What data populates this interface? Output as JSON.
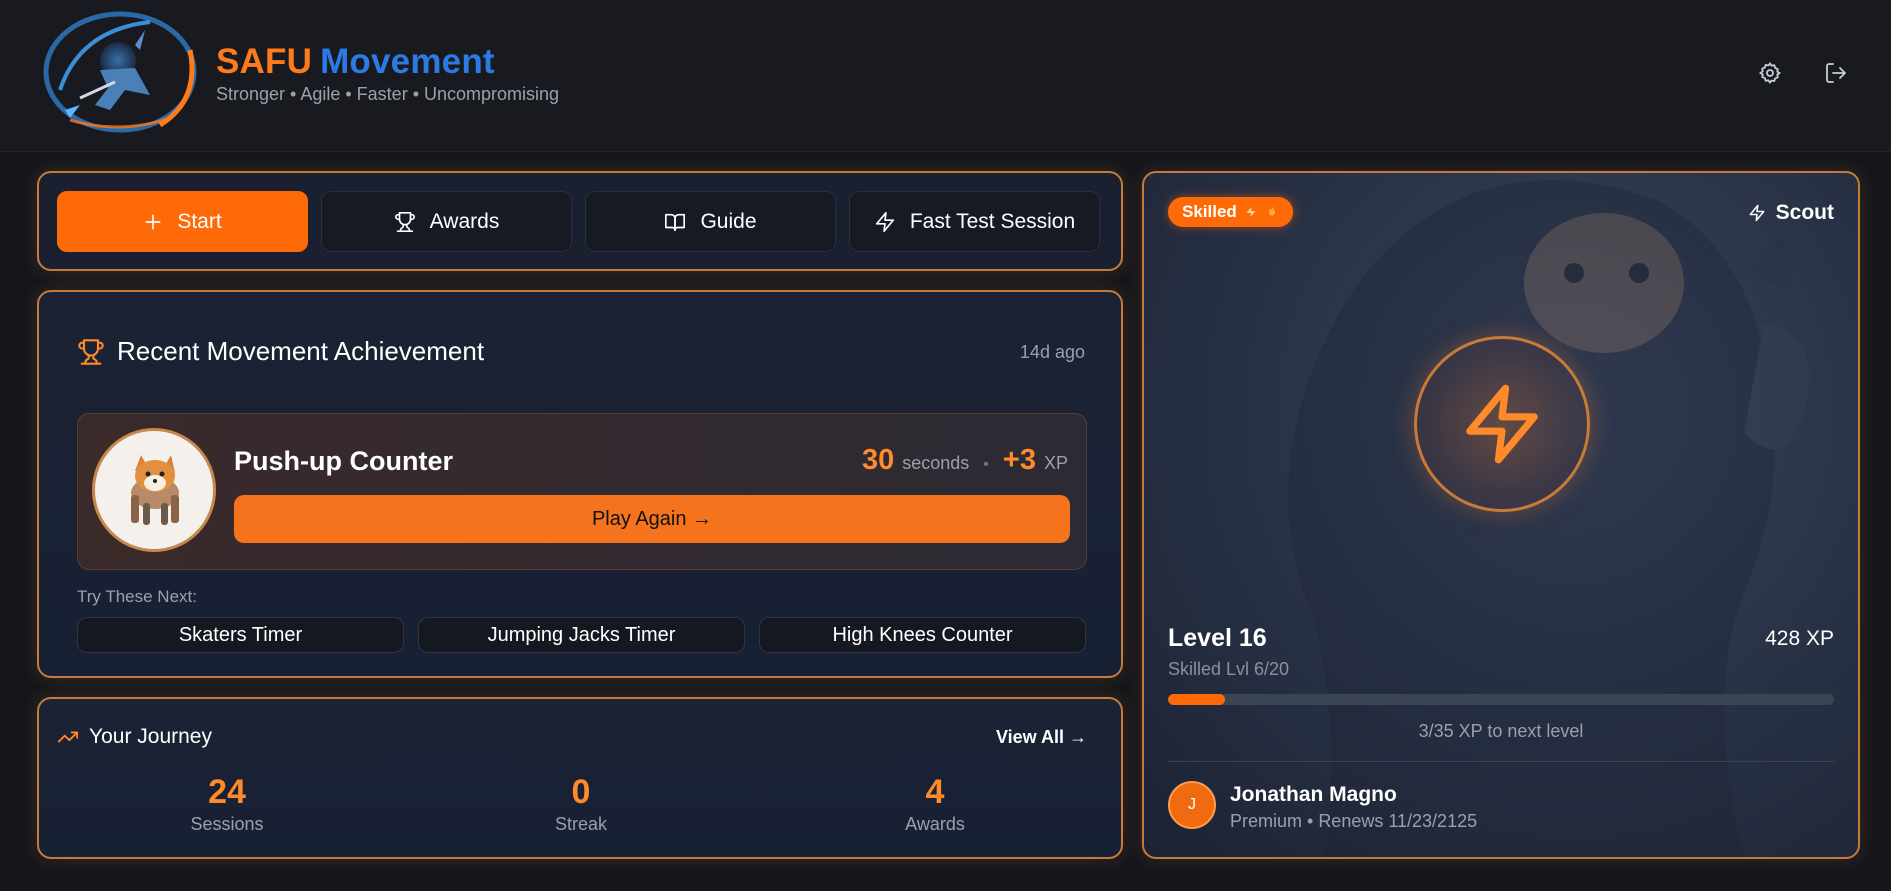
{
  "header": {
    "brand_part1": "SAFU",
    "brand_part2": "Movement",
    "tagline": "Stronger • Agile • Faster • Uncompromising",
    "icons": [
      "gear-icon",
      "logout-icon"
    ]
  },
  "actions": [
    {
      "label": "Start",
      "icon": "plus-icon"
    },
    {
      "label": "Awards",
      "icon": "trophy-icon"
    },
    {
      "label": "Guide",
      "icon": "book-icon"
    },
    {
      "label": "Fast Test Session",
      "icon": "bolt-icon"
    }
  ],
  "achievement": {
    "title": "Recent Movement Achievement",
    "time_ago": "14d ago",
    "card": {
      "name": "Push-up Counter",
      "value": "30",
      "unit": "seconds",
      "xp_value": "+3",
      "xp_unit": "XP",
      "play_label": "Play Again →"
    },
    "try_label": "Try These Next:",
    "next": [
      "Skaters Timer",
      "Jumping Jacks Timer",
      "High Knees Counter"
    ]
  },
  "journey": {
    "title": "Your Journey",
    "view_all": "View All →",
    "stats": [
      {
        "value": "24",
        "label": "Sessions"
      },
      {
        "value": "0",
        "label": "Streak"
      },
      {
        "value": "4",
        "label": "Awards"
      }
    ]
  },
  "profile": {
    "badge": "Skilled",
    "rank": "Scout",
    "level": "Level 16",
    "xp_total": "428 XP",
    "sub_level": "Skilled Lvl 6/20",
    "progress_fraction": 0.086,
    "progress_text": "3/35 XP to next level",
    "user_initial": "J",
    "user_name": "Jonathan Magno",
    "user_plan": "Premium • Renews 11/23/2125"
  },
  "colors": {
    "accent": "#ff6a08",
    "brand_blue": "#2a7be4",
    "panel_border": "#c57a3c",
    "background": "#15171d"
  }
}
